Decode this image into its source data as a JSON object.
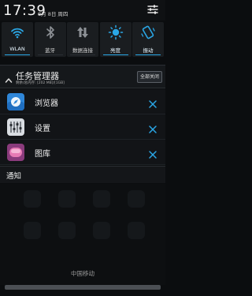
{
  "status_bar": {
    "time": "17:39",
    "date": "8月 8日 周四"
  },
  "quick_toggles": [
    {
      "label": "WLAN",
      "icon": "wifi-icon",
      "active": true
    },
    {
      "label": "蓝牙",
      "icon": "bluetooth-icon",
      "active": false
    },
    {
      "label": "数据连接",
      "icon": "data-connection-icon",
      "active": false
    },
    {
      "label": "亮度",
      "icon": "brightness-icon",
      "active": true
    },
    {
      "label": "振动",
      "icon": "vibrate-icon",
      "active": true
    }
  ],
  "task_manager": {
    "title": "任务管理器",
    "memory_text": "剩余/总内存: [202 MB]/[1GB]",
    "close_all_label": "全部关闭",
    "tasks": [
      {
        "label": "浏览器",
        "icon": "browser-icon"
      },
      {
        "label": "设置",
        "icon": "settings-app-icon"
      },
      {
        "label": "图库",
        "icon": "gallery-icon"
      }
    ]
  },
  "notifications": {
    "header": "通知"
  },
  "carrier": "中国移动",
  "colors": {
    "accent": "#2aa7e6",
    "background": "#0b0d0f"
  }
}
